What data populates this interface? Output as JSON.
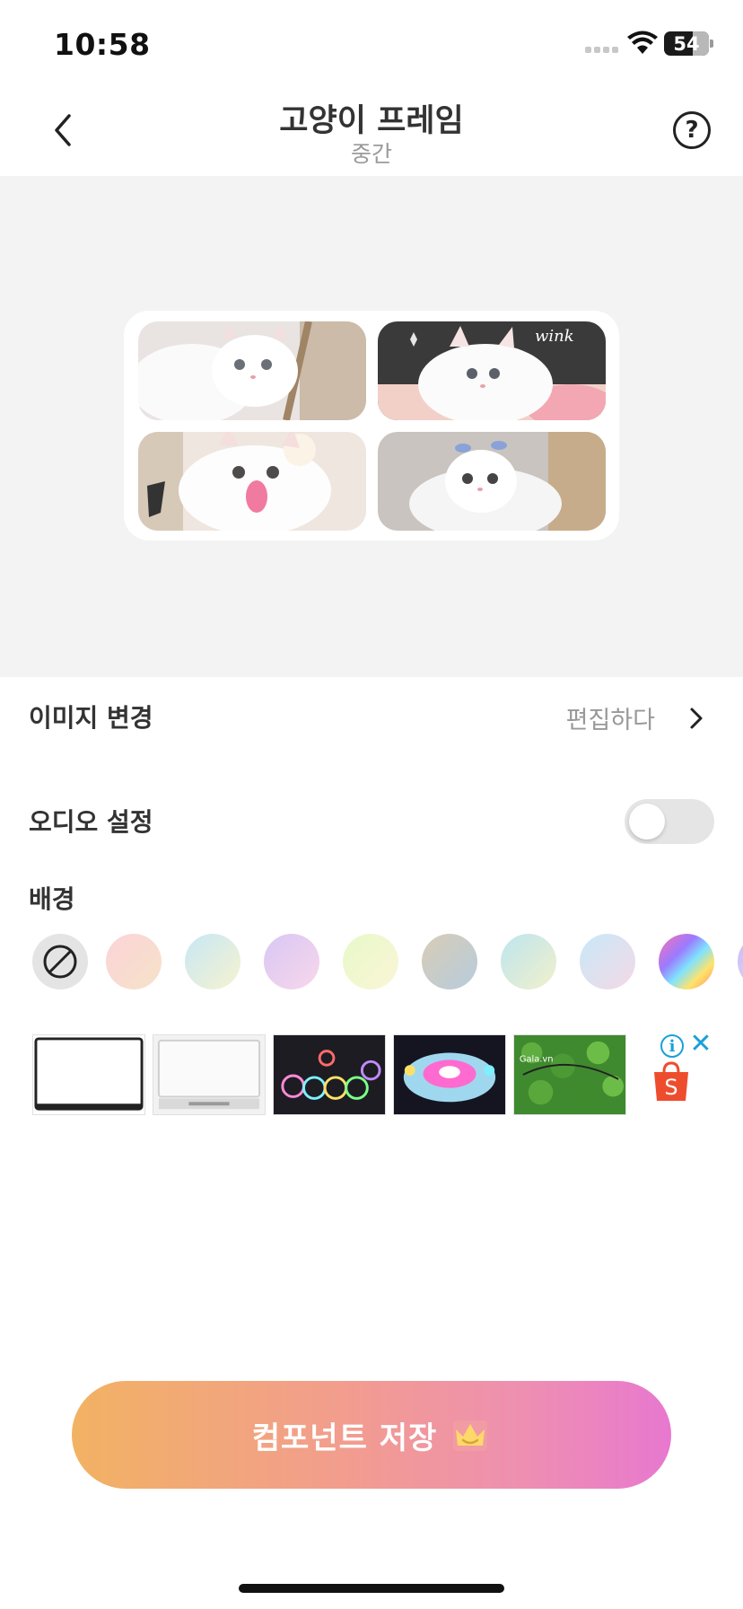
{
  "status_bar": {
    "time": "10:58",
    "battery": "54"
  },
  "header": {
    "title": "고양이 프레임",
    "subtitle": "중간",
    "help_symbol": "?"
  },
  "preview": {
    "photo_captions": [
      "",
      "wink",
      "",
      ""
    ]
  },
  "settings": {
    "change_image": {
      "label": "이미지 변경",
      "value": "편집하다"
    },
    "audio": {
      "label": "오디오 설정",
      "enabled": false
    },
    "background": {
      "label": "배경"
    }
  },
  "swatches": {
    "options": [
      {
        "name": "none",
        "icon": "no-symbol-icon"
      },
      {
        "name": "pink-peach",
        "colors": [
          "#fbd3d8",
          "#f6e3c8"
        ]
      },
      {
        "name": "sky-cream",
        "colors": [
          "#c7e7f6",
          "#f6f3cf"
        ]
      },
      {
        "name": "lavender-pink",
        "colors": [
          "#d8c7f4",
          "#f8d7ea"
        ]
      },
      {
        "name": "lime-cream",
        "colors": [
          "#e7f8c8",
          "#fbf6d7"
        ]
      },
      {
        "name": "taupe-blue",
        "colors": [
          "#d8cdb6",
          "#b7cbdd"
        ]
      },
      {
        "name": "aqua-cream",
        "colors": [
          "#bde5ee",
          "#f2f0cc"
        ]
      },
      {
        "name": "blue-pink",
        "colors": [
          "#c8e8f8",
          "#f4d9e6"
        ]
      },
      {
        "name": "rainbow",
        "colors": [
          "#ff6fb0",
          "#9b7bff",
          "#7fe3ff",
          "#ffe36a"
        ]
      },
      {
        "name": "lilac",
        "colors": [
          "#c9b8f6",
          "#e8e2fb"
        ]
      }
    ]
  },
  "ad": {
    "info_symbol": "i",
    "close_symbol": "✕",
    "brand_icon": "shopping-bag-icon",
    "brand_letter": "S",
    "thumb_texts": [
      "",
      "",
      "",
      "",
      "Gala.vn"
    ]
  },
  "save_button": {
    "label": "컴포넌트 저장",
    "icon": "crown-icon"
  },
  "colors": {
    "accent_start": "#f2b263",
    "accent_end": "#e878cf",
    "preview_bg": "#f3f3f3",
    "ad_blue": "#1aa0d8",
    "shopee_orange": "#ee4d2d"
  }
}
